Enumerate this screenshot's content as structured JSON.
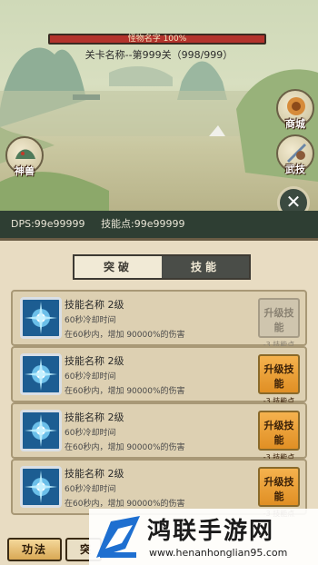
{
  "scene": {
    "monster_hp_label": "怪物名字 100%",
    "stage_label": "关卡名称--第999关（998/999）",
    "shop_label": "商城",
    "beast_label": "神兽",
    "martial_label": "武技",
    "close_symbol": "✕"
  },
  "stats": {
    "dps": "DPS:99e99999",
    "skill_points": "技能点:99e99999"
  },
  "tabs": {
    "breakthrough": "突破",
    "skills": "技能"
  },
  "skills": [
    {
      "name": "技能名称  2级",
      "cooldown": "60秒冷却时间",
      "desc": "在60秒内，增加 90000%的伤害",
      "button": "升级技能",
      "cost": "-3 技能点",
      "state": "disabled"
    },
    {
      "name": "技能名称  2级",
      "cooldown": "60秒冷却时间",
      "desc": "在60秒内，增加 90000%的伤害",
      "button": "升级技能",
      "cost": "-3 技能点",
      "state": "active"
    },
    {
      "name": "技能名称  2级",
      "cooldown": "60秒冷却时间",
      "desc": "在60秒内，增加 90000%的伤害",
      "button": "升级技能",
      "cost": "-3 技能点",
      "state": "active"
    },
    {
      "name": "技能名称  2级",
      "cooldown": "60秒冷却时间",
      "desc": "在60秒内，增加 90000%的伤害",
      "button": "升级技能",
      "cost": "-3 技能点",
      "state": "active"
    }
  ],
  "bottom_nav": {
    "kungfu": "功法",
    "second_partial": "突"
  },
  "watermark": {
    "title": "鸿联手游网",
    "url": "www.henanhonglian95.com"
  },
  "colors": {
    "active_button": "#f5b24e",
    "hp_bar": "#b3332c",
    "panel_bg": "#e8dcc2"
  }
}
